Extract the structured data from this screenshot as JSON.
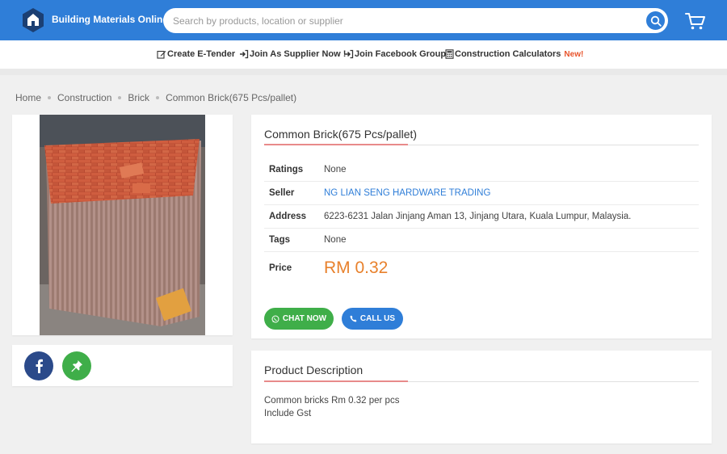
{
  "header": {
    "brand": "Building Materials Online",
    "search_placeholder": "Search by products, location or supplier",
    "search_value": ""
  },
  "nav": {
    "items": [
      {
        "label": "Create E-Tender",
        "icon": "edit-icon"
      },
      {
        "label": "Join As Supplier Now !",
        "icon": "sign-in-icon"
      },
      {
        "label": "Join Facebook Group",
        "icon": "sign-in-icon"
      },
      {
        "label": "Construction Calculators",
        "icon": "calculator-icon"
      }
    ],
    "new_badge": "New!"
  },
  "breadcrumb": [
    "Home",
    "Construction",
    "Brick",
    "Common Brick(675 Pcs/pallet)"
  ],
  "product": {
    "title": "Common Brick(675 Pcs/pallet)",
    "ratings_label": "Ratings",
    "ratings_value": "None",
    "seller_label": "Seller",
    "seller_value": "NG LIAN SENG HARDWARE TRADING",
    "address_label": "Address",
    "address_value": "6223-6231 Jalan Jinjang Aman 13, Jinjang Utara, Kuala Lumpur, Malaysia.",
    "tags_label": "Tags",
    "tags_value": "None",
    "price_label": "Price",
    "price_value": "RM 0.32",
    "chat_label": "CHAT NOW",
    "call_label": "CALL US"
  },
  "description": {
    "title": "Product Description",
    "lines": [
      "Common bricks Rm 0.32 per pcs",
      "Include Gst"
    ]
  },
  "colors": {
    "primary": "#2f7ed8",
    "green": "#3fae49",
    "price": "#e8812c",
    "facebook": "#2b4a8a"
  }
}
